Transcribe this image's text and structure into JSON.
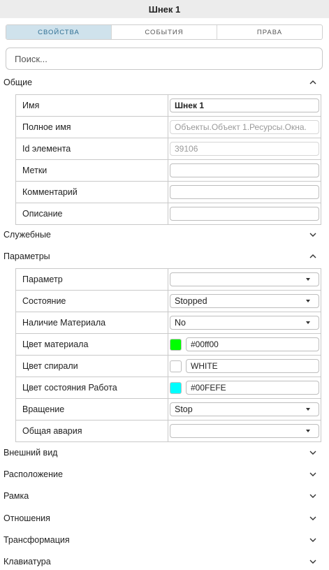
{
  "window": {
    "title": "Шнек 1"
  },
  "tabs": [
    {
      "label": "СВОЙСТВА",
      "active": true
    },
    {
      "label": "СОБЫТИЯ",
      "active": false
    },
    {
      "label": "ПРАВА",
      "active": false
    }
  ],
  "search": {
    "placeholder": "Поиск..."
  },
  "sections": {
    "general": {
      "label": "Общие",
      "expanded": true
    },
    "service": {
      "label": "Служебные",
      "expanded": false
    },
    "params": {
      "label": "Параметры",
      "expanded": true
    },
    "appearance": {
      "label": "Внешний вид",
      "expanded": false
    },
    "location": {
      "label": "Расположение",
      "expanded": false
    },
    "frame": {
      "label": "Рамка",
      "expanded": false
    },
    "relations": {
      "label": "Отношения",
      "expanded": false
    },
    "transform": {
      "label": "Трансформация",
      "expanded": false
    },
    "keyboard": {
      "label": "Клавиатура",
      "expanded": false
    }
  },
  "general": {
    "name": {
      "label": "Имя",
      "value": "Шнек 1"
    },
    "fullname": {
      "label": "Полное имя",
      "value": "Объекты.Объект 1.Ресурсы.Окна."
    },
    "id": {
      "label": "Id элемента",
      "value": "39106"
    },
    "tags": {
      "label": "Метки",
      "value": ""
    },
    "comment": {
      "label": "Комментарий",
      "value": ""
    },
    "description": {
      "label": "Описание",
      "value": ""
    }
  },
  "params": {
    "param": {
      "label": "Параметр",
      "value": ""
    },
    "state": {
      "label": "Состояние",
      "value": "Stopped"
    },
    "material_presence": {
      "label": "Наличие Материала",
      "value": "No"
    },
    "material_color": {
      "label": "Цвет материала",
      "value": "#00ff00",
      "color": "#00ff00"
    },
    "spiral_color": {
      "label": "Цвет спирали",
      "value": "WHITE",
      "color": "#ffffff"
    },
    "work_color": {
      "label": "Цвет состояния Работа",
      "value": "#00FEFE",
      "color": "#00fefe"
    },
    "rotation": {
      "label": "Вращение",
      "value": "Stop"
    },
    "alarm": {
      "label": "Общая авария",
      "value": ""
    }
  },
  "icons": {
    "expanded": "chevron-up-icon",
    "collapsed": "chevron-down-icon",
    "dropdown": "caret-down-icon"
  }
}
